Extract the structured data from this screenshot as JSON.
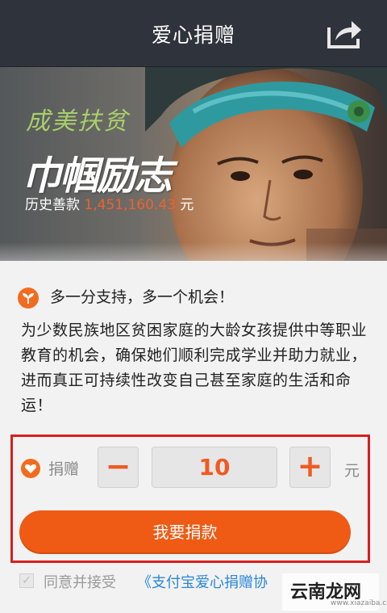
{
  "header": {
    "title": "爱心捐赠",
    "share_icon": "share-icon"
  },
  "hero": {
    "slogan_top": "成美扶贫",
    "slogan_main": "巾帼励志",
    "history_label": "历史善款",
    "history_amount": "1,451,160.43",
    "history_unit": "元"
  },
  "intro": {
    "icon": "sprout-icon",
    "heading": "多一分支持，多一个机会！",
    "body": "为少数民族地区贫困家庭的大龄女孩提供中等职业教育的机会，确保她们顺利完成学业并助力就业，进而真正可持续性改变自己甚至家庭的生活和命运！"
  },
  "donation": {
    "icon": "heart-icon",
    "label": "捐赠",
    "minus": "−",
    "amount": "10",
    "plus": "+",
    "unit": "元",
    "submit_label": "我要捐款"
  },
  "agreement": {
    "checked": true,
    "text": "同意并接受",
    "link": "《支付宝爱心捐赠协"
  },
  "watermark": {
    "text": "云南龙网",
    "sub": "www.xiazaiba.com"
  },
  "colors": {
    "accent": "#ef5a14",
    "header_bg": "#2f333b",
    "link": "#2a87d8",
    "highlight": "#d81e1e"
  }
}
